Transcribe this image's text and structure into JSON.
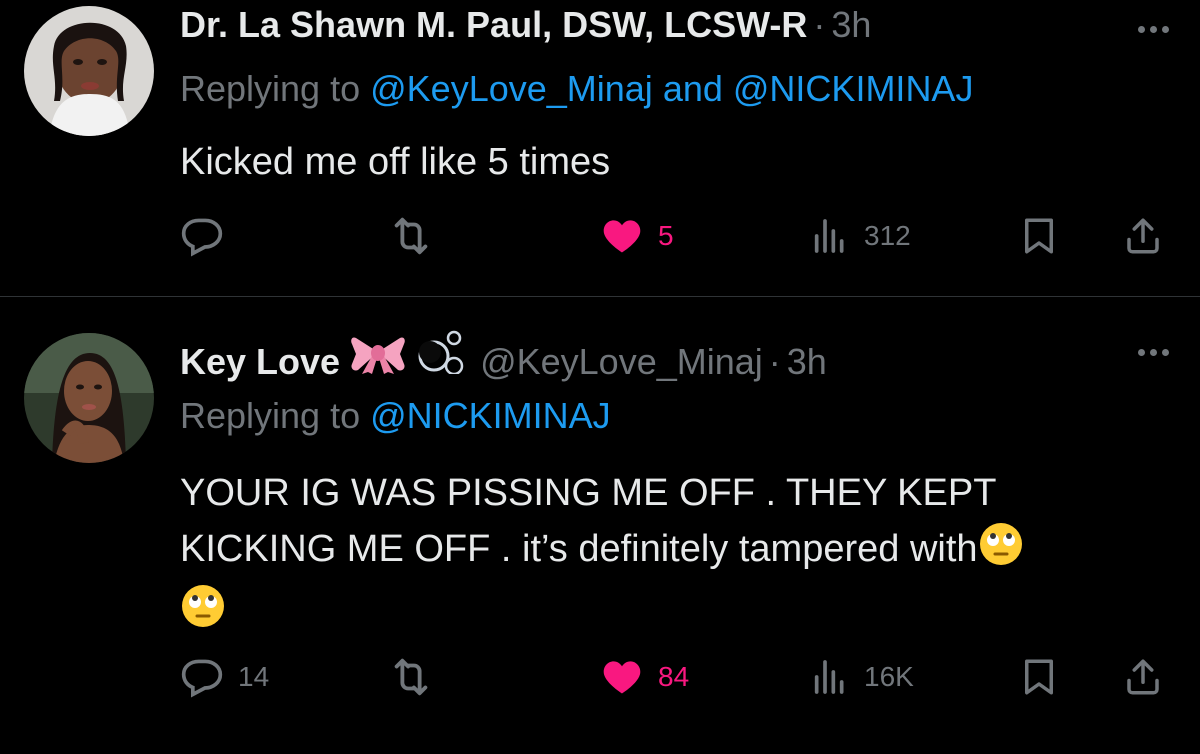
{
  "tweets": [
    {
      "name": "Dr. La Shawn M. Paul, DSW, LCSW-R",
      "handle": "",
      "time": "3h",
      "replying_prefix": "Replying to ",
      "mentions": [
        "@KeyLove_Minaj",
        "@NICKIMINAJ"
      ],
      "mention_joiner": " and ",
      "text": "Kicked me off like 5 times",
      "text_line2": "",
      "text_line3": "",
      "replies": "",
      "retweets": "",
      "likes": "5",
      "views": "312",
      "liked": true
    },
    {
      "name": "Key Love",
      "handle": "@KeyLove_Minaj",
      "time": "3h",
      "replying_prefix": "Replying to ",
      "mentions": [
        "@NICKIMINAJ"
      ],
      "text": "YOUR IG WAS PISSING ME OFF . THEY KEPT",
      "text_line2": "KICKING ME OFF . it’s definitely tampered with",
      "text_line3": "",
      "replies": "14",
      "retweets": "",
      "likes": "84",
      "views": "16K",
      "liked": true
    }
  ],
  "icons": {
    "reply": "reply-icon",
    "retweet": "retweet-icon",
    "like": "heart-icon",
    "views": "views-icon",
    "bookmark": "bookmark-icon",
    "share": "share-icon",
    "more": "more-icon",
    "name_emojis": [
      "ribbon-bow-emoji",
      "bubbles-emoji"
    ],
    "text_emoji": "eye-roll-emoji"
  },
  "colors": {
    "background": "#000000",
    "text": "#e7e9ea",
    "muted": "#71767b",
    "link": "#1d9bf0",
    "like": "#f91880"
  }
}
